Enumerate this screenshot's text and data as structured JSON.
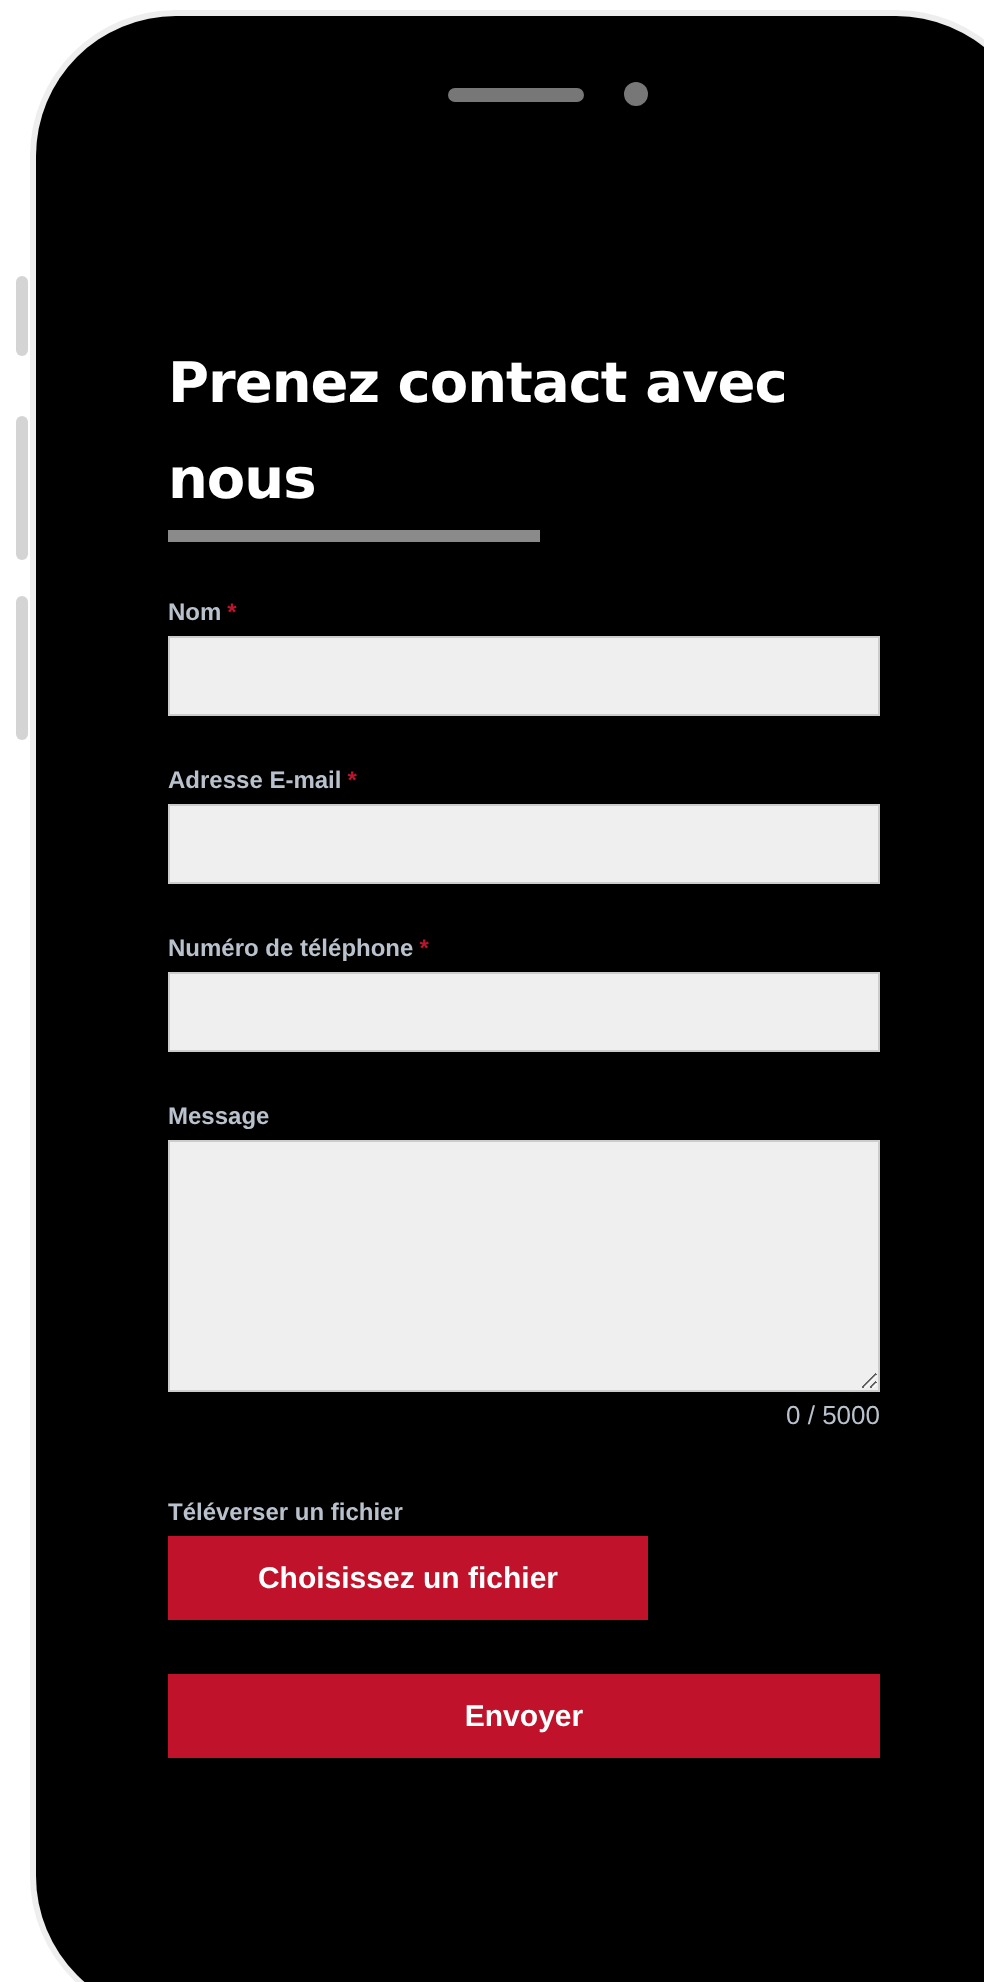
{
  "title": "Prenez contact avec nous",
  "fields": [
    {
      "label": "Nom",
      "required_mark": "*",
      "kind": "text"
    },
    {
      "label": "Adresse E-mail",
      "required_mark": "*",
      "kind": "text"
    },
    {
      "label": "Numéro de téléphone",
      "required_mark": "*",
      "kind": "text"
    },
    {
      "label": "Message",
      "kind": "textarea",
      "counter": "0 / 5000"
    }
  ],
  "upload": {
    "label": "Téléverser un fichier",
    "button": "Choisissez un fichier"
  },
  "submit": "Envoyer"
}
